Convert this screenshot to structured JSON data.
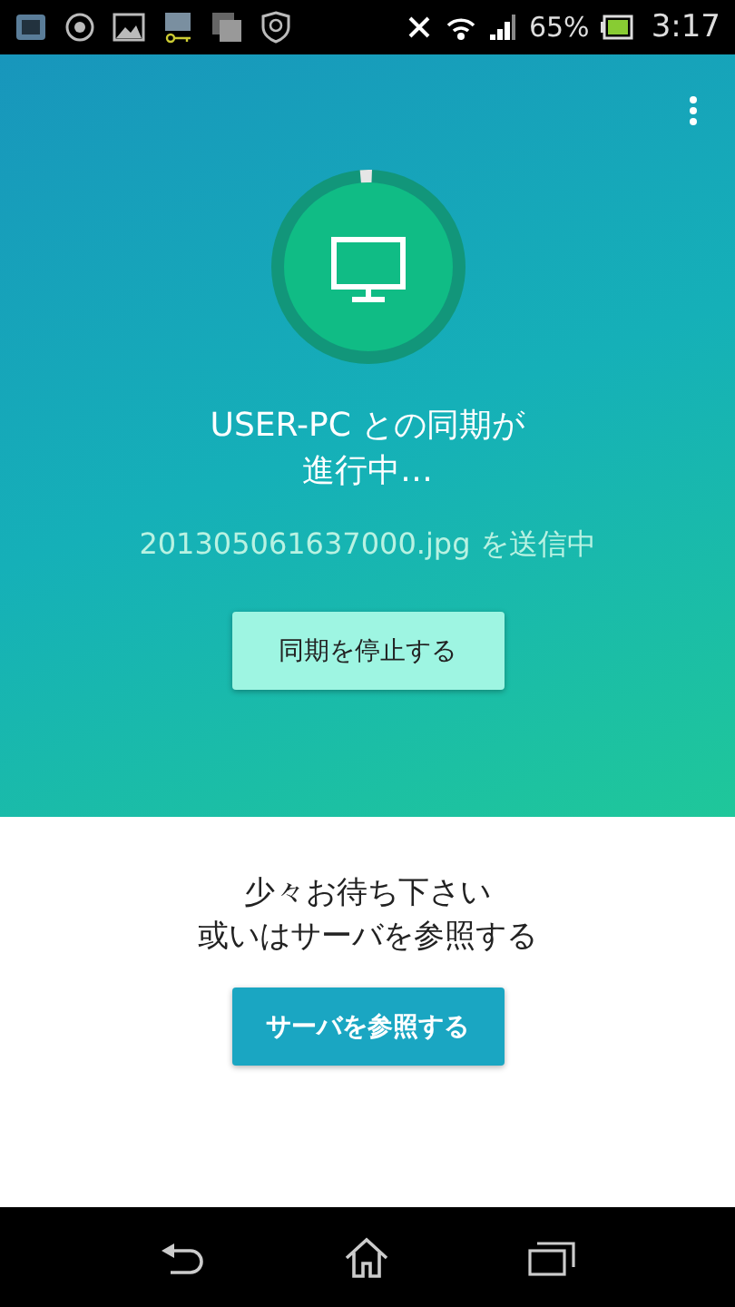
{
  "status_bar": {
    "battery_text": "65%",
    "time": "3:17"
  },
  "sync": {
    "progress": {
      "level": 0.02
    },
    "title_lines": [
      "USER-PC との同期が",
      "進行中…"
    ],
    "file_status": "201305061637000.jpg を送信中",
    "stop_button": "同期を停止する"
  },
  "server": {
    "message_lines": [
      "少々お待ち下さい",
      "或いはサーバを参照する"
    ],
    "browse_button": "サーバを参照する"
  }
}
